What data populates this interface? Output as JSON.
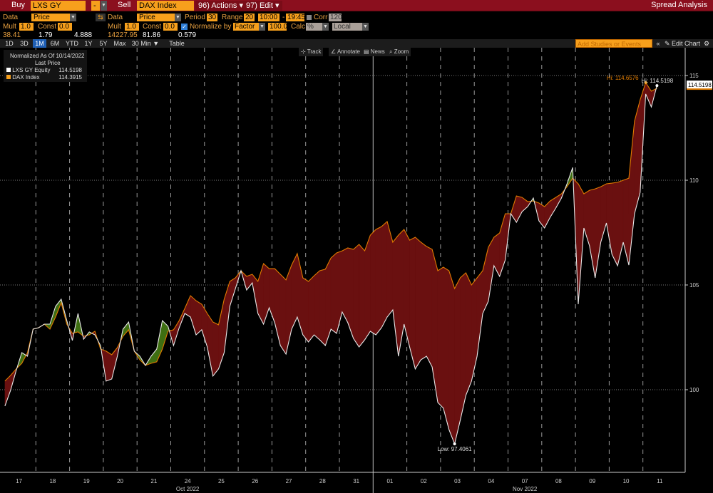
{
  "topbar": {
    "buy_label": "Buy",
    "buy_ticker": "LXS GY Equity",
    "op": "-",
    "sell_label": "Sell",
    "sell_ticker": "DAX Index",
    "actions": "96) Actions ▾",
    "edit": "97) Edit ▾",
    "title": "Spread Analysis"
  },
  "row1": {
    "data_label": "Data",
    "data_value": "Price",
    "data2_label": "Data",
    "data2_value": "Price",
    "period_label": "Period",
    "period": "30",
    "range_label": "Range",
    "range": "20",
    "time_from": "10:00",
    "dash": "-",
    "time_to": "19:45",
    "corr_label": "Corr",
    "corr": "120",
    "corr_checked": false
  },
  "row2": {
    "mult_label": "Mult",
    "mult": "1.0",
    "const_label": "Const",
    "const": "0.0",
    "mult2_label": "Mult",
    "mult2": "1.0",
    "const2_label": "Const",
    "const2": "0.0",
    "normalize_label": "Normalize by",
    "normalize_checked": true,
    "normalize_value": "Factor",
    "factor": "100.0",
    "calc_label": "Calc",
    "calc_value": "%",
    "currency": "Local"
  },
  "row3": {
    "v1": "38.41",
    "v2": "1.79",
    "v3": "4.888",
    "v4": "14227.95",
    "v5": "81.86",
    "v6": "0.579"
  },
  "tabs": [
    {
      "label": "1D"
    },
    {
      "label": "3D"
    },
    {
      "label": "1M",
      "active": true
    },
    {
      "label": "6M"
    },
    {
      "label": "YTD"
    },
    {
      "label": "1Y"
    },
    {
      "label": "5Y"
    },
    {
      "label": "Max"
    },
    {
      "label": "30 Min ▼"
    },
    {
      "label": "Table"
    }
  ],
  "toolbar": {
    "add_studies_placeholder": "Add Studies or Events",
    "collapse": "«",
    "edit_chart": "✎ Edit Chart",
    "settings": "⚙"
  },
  "chart_tools": {
    "track": "Track",
    "annotate": "Annotate",
    "news": "News",
    "zoom": "Zoom"
  },
  "legend": {
    "title": "Normalized As Of 10/14/2022",
    "subtitle": "Last Price",
    "items": [
      {
        "name": "LXS GY Equity",
        "value": "114.5198",
        "color": "#ffffff"
      },
      {
        "name": "DAX Index",
        "value": "114.3915",
        "color": "#f7a01c"
      }
    ]
  },
  "chart_data": {
    "type": "area",
    "ylim": [
      96.5,
      116
    ],
    "yticks": [
      "100",
      "105",
      "110",
      "115"
    ],
    "grid": true,
    "legend_position": "top-left",
    "colors": {
      "lxs": "#e8e8e8",
      "dax": "#e07b00",
      "fill_lxs_below": "#6a1010",
      "fill_lxs_above": "#3f6f12"
    },
    "days": [
      "17",
      "18",
      "19",
      "20",
      "21",
      "24",
      "25",
      "26",
      "27",
      "28",
      "31",
      "01",
      "02",
      "03",
      "04",
      "07",
      "08",
      "09",
      "10",
      "11"
    ],
    "month_labels": [
      {
        "label": "Oct 2022",
        "day": "24"
      },
      {
        "label": "Nov 2022",
        "day": "07"
      }
    ],
    "series": [
      {
        "name": "LXS GY Equity",
        "values": [
          [
            99.22,
            99.97,
            100.92,
            101.77,
            101.6,
            102.89
          ],
          [
            102.96,
            103.13,
            103.13,
            103.98,
            104.32,
            103.3
          ],
          [
            102.35,
            103.64,
            102.41,
            102.76,
            102.62,
            102.11
          ],
          [
            100.41,
            100.51,
            101.6,
            102.89,
            103.23,
            101.84
          ],
          [
            101.6,
            101.16,
            101.6,
            101.94,
            103.3,
            103.03
          ],
          [
            102.11,
            102.96,
            103.64,
            103.47,
            102.62,
            102.86
          ],
          [
            102.04,
            100.65,
            100.99,
            101.77,
            103.98,
            104.83
          ],
          [
            105.68,
            104.76,
            105.1,
            103.64,
            103.13,
            103.91
          ],
          [
            103.2,
            102.11,
            101.7,
            102.89,
            103.47,
            102.62
          ],
          [
            102.28,
            102.62,
            102.38,
            102.11,
            102.89,
            102.69
          ],
          [
            103.71,
            103.2,
            102.45,
            102.04,
            102.38,
            102.79
          ],
          [
            102.62,
            102.96,
            103.47,
            103.81,
            101.6,
            103.13
          ],
          [
            102.04,
            100.99,
            101.43,
            101.6,
            101.09,
            99.39
          ],
          [
            99.12,
            98.1,
            97.41,
            98.54,
            99.73,
            100.41
          ],
          [
            101.6,
            103.64,
            104.22,
            105.92,
            105.41,
            106.19
          ],
          [
            108.4,
            107.99,
            108.5,
            108.74,
            109.15,
            108.06
          ],
          [
            107.72,
            108.23,
            108.67,
            109.15,
            109.83,
            110.61
          ],
          [
            104.08,
            107.72,
            106.87,
            105.34,
            107.04,
            107.96
          ],
          [
            106.46,
            105.92,
            107.04,
            105.95,
            108.4,
            109.42
          ],
          [
            114.12,
            113.5,
            114.52
          ]
        ]
      },
      {
        "name": "DAX Index",
        "values": [
          [
            100.41,
            100.68,
            100.99,
            101.26,
            101.77,
            102.89
          ],
          [
            102.96,
            103.13,
            102.89,
            103.47,
            104.15,
            103.13
          ],
          [
            102.69,
            102.76,
            102.55,
            102.62,
            102.79,
            101.94
          ],
          [
            101.84,
            101.67,
            102.01,
            102.55,
            102.86,
            101.84
          ],
          [
            101.43,
            101.16,
            101.26,
            101.33,
            101.94,
            102.79
          ],
          [
            102.86,
            103.3,
            103.88,
            104.49,
            104.25,
            104.08
          ],
          [
            103.64,
            103.23,
            103.1,
            104.32,
            105.17,
            105.34
          ],
          [
            105.68,
            105.41,
            105.51,
            105.17,
            106.02,
            105.78
          ],
          [
            105.78,
            105.51,
            105.24,
            105.95,
            106.5,
            105.34
          ],
          [
            105.17,
            105.44,
            105.68,
            105.75,
            106.29,
            106.53
          ],
          [
            106.63,
            106.77,
            106.7,
            106.94,
            106.63,
            107.38
          ],
          [
            107.65,
            107.79,
            108.03,
            107.04,
            107.38,
            107.65
          ],
          [
            107.14,
            107.28,
            107.04,
            106.84,
            106.7,
            105.68
          ],
          [
            105.85,
            105.68,
            104.83,
            105.34,
            105.58,
            105.0
          ],
          [
            105.34,
            105.68,
            106.8,
            107.28,
            107.48,
            108.4
          ],
          [
            108.4,
            109.25,
            109.18,
            108.98,
            109.01,
            108.91
          ],
          [
            108.74,
            109.01,
            109.18,
            109.35,
            109.69,
            110.1
          ],
          [
            109.83,
            109.35,
            109.52,
            109.59,
            109.69,
            109.83
          ],
          [
            109.86,
            109.9,
            110.0,
            110.1,
            112.82,
            113.84
          ],
          [
            114.66,
            114.25,
            114.39
          ]
        ]
      }
    ],
    "annotations": {
      "dax_high": "Hi: 114.6576",
      "lxs_high": "Hi: 114.5198",
      "lxs_low": "Low: 97.4061",
      "last_price_tag": "114.5198"
    }
  }
}
